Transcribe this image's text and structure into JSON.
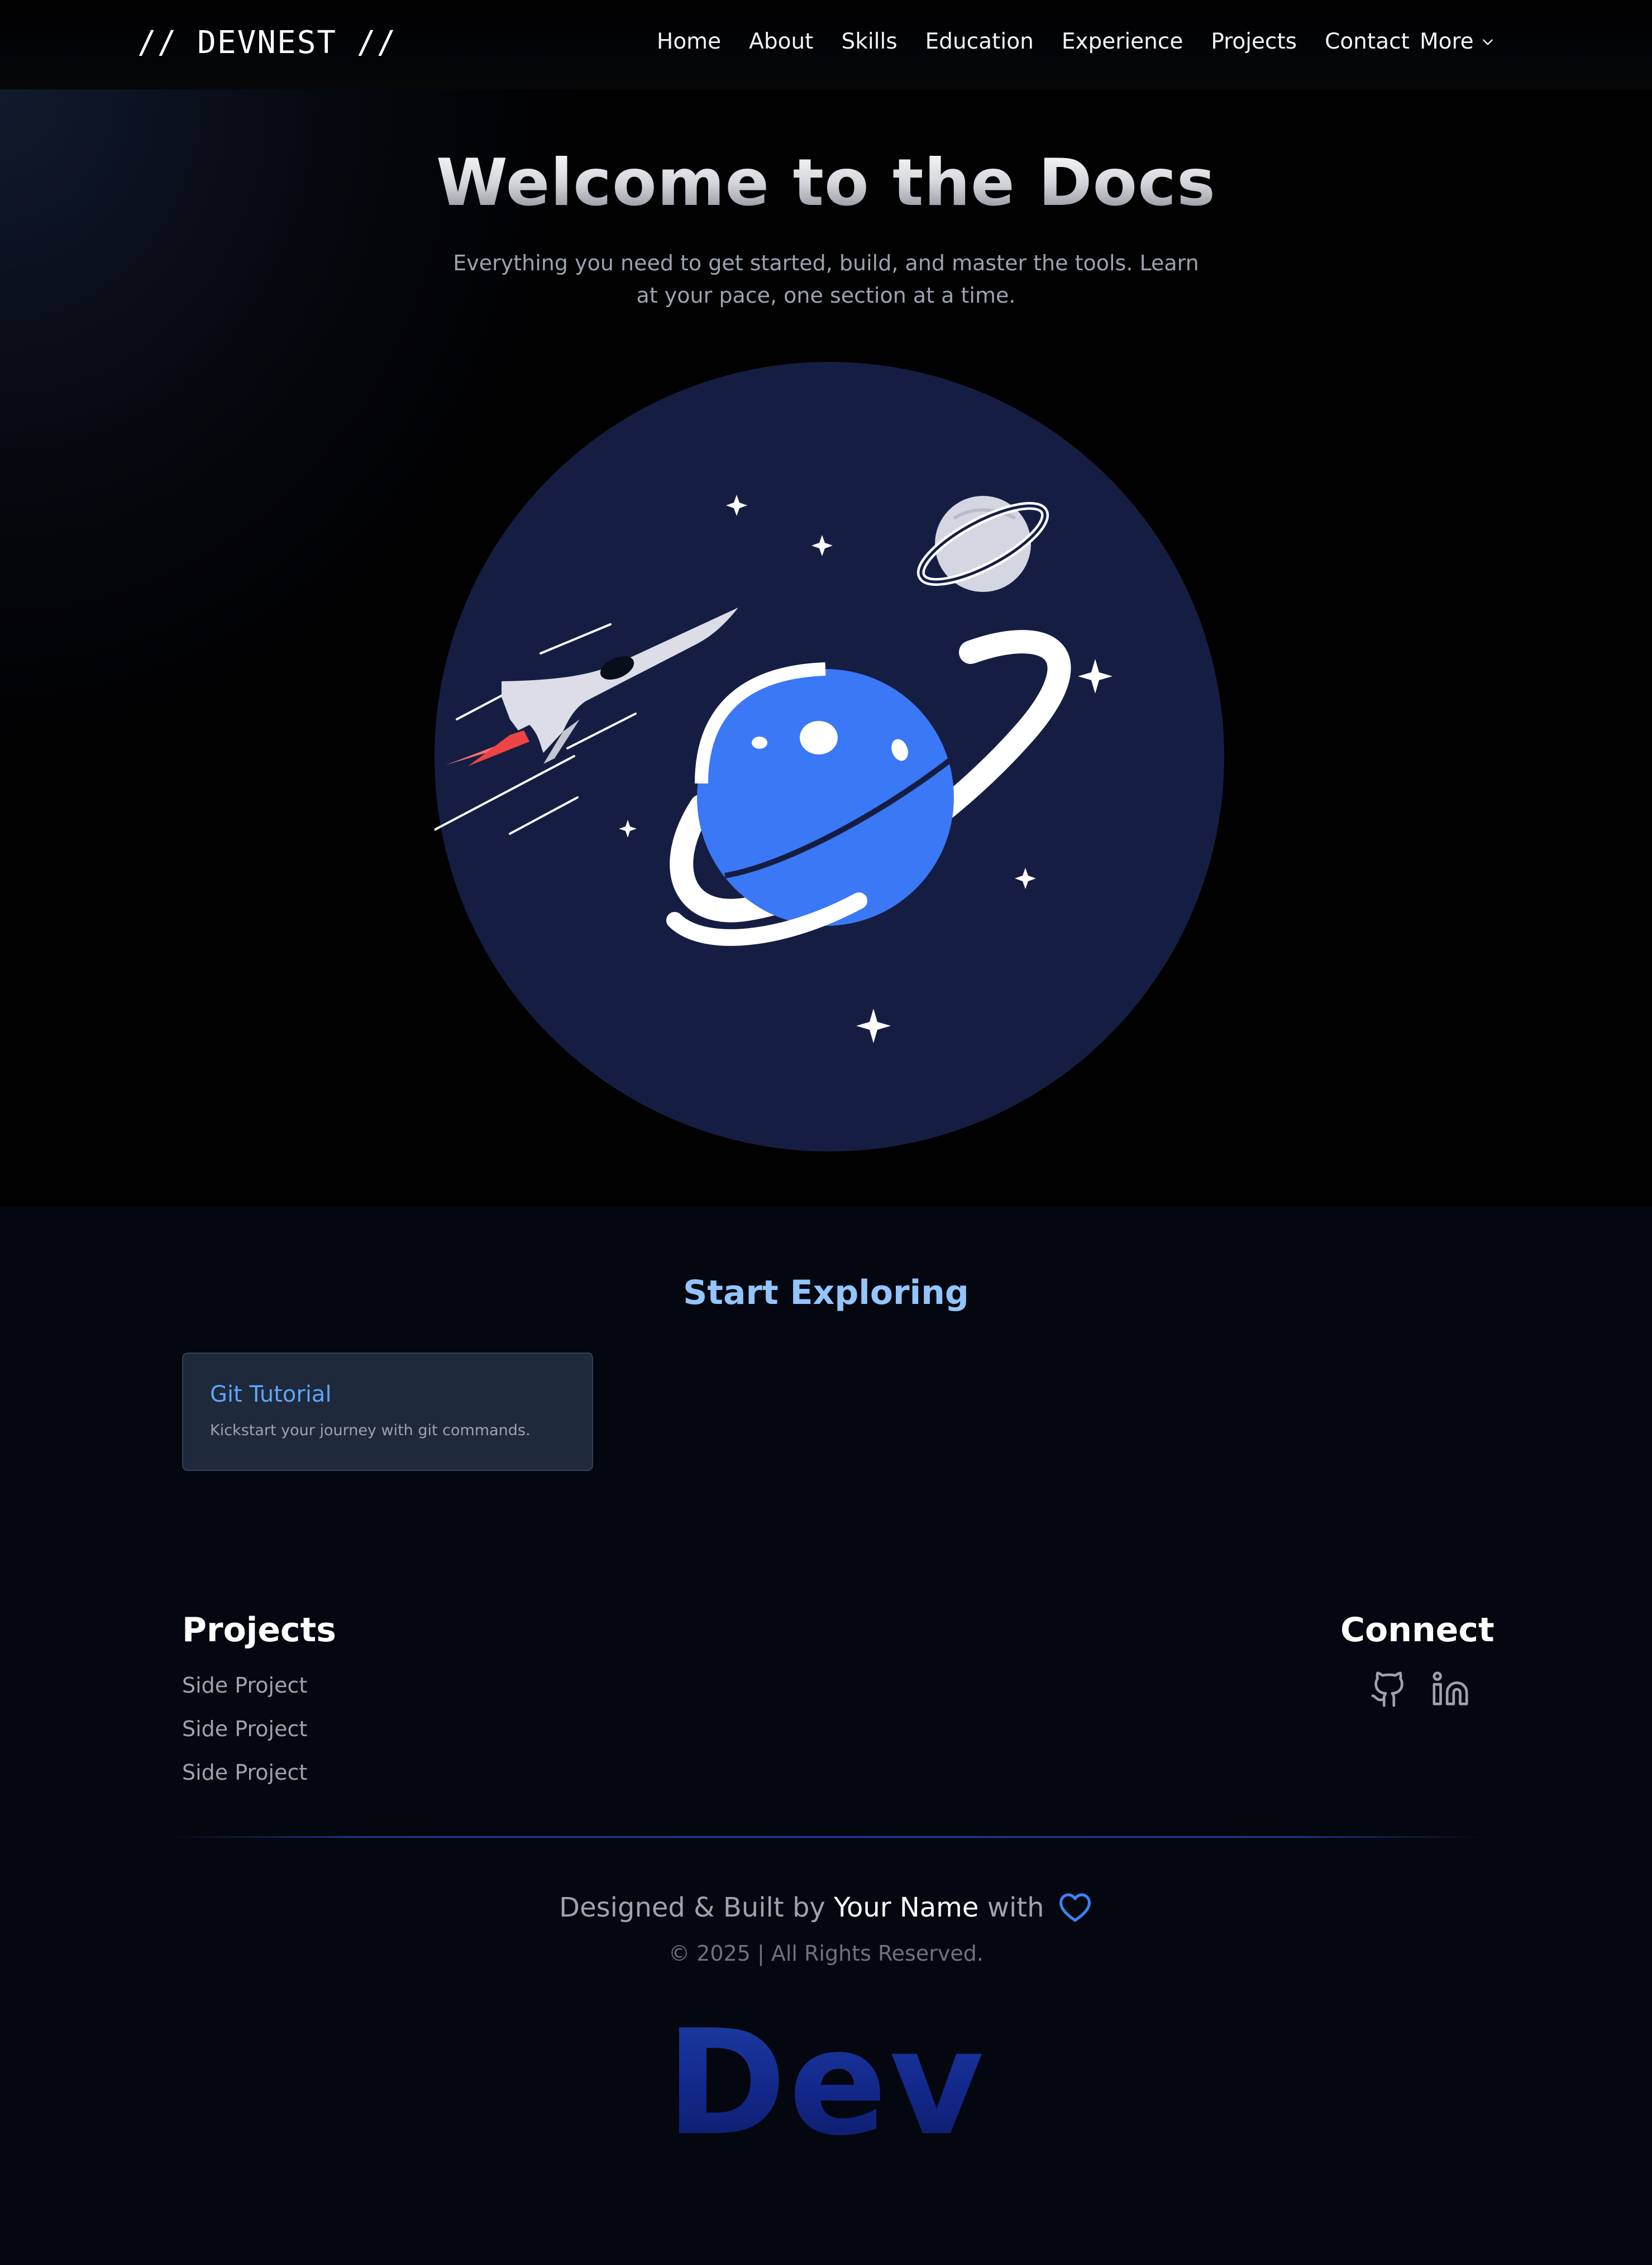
{
  "nav": {
    "logo": "// DEVNEST //",
    "links": [
      "Home",
      "About",
      "Skills",
      "Education",
      "Experience",
      "Projects",
      "Contact"
    ],
    "more_label": "More"
  },
  "hero": {
    "title": "Welcome to the Docs",
    "subtitle": "Everything you need to get started, build, and master the tools. Learn at your pace, one section at a time."
  },
  "explore": {
    "title": "Start Exploring",
    "cards": [
      {
        "title": "Git Tutorial",
        "description": "Kickstart your journey with git commands."
      }
    ]
  },
  "footer": {
    "projects_title": "Projects",
    "projects": [
      "Side Project",
      "Side Project",
      "Side Project"
    ],
    "connect_title": "Connect",
    "socials": [
      "github-icon",
      "linkedin-icon"
    ],
    "credit_prefix": "Designed & Built by",
    "credit_name": "Your Name",
    "credit_suffix": "with",
    "copyright": "© 2025 | All Rights Reserved.",
    "wordmark": "Dev"
  },
  "colors": {
    "accent": "#3b82f6",
    "accent_light": "#93c5fd",
    "card_bg": "#1e293b",
    "illustration_bg": "#151e42"
  }
}
